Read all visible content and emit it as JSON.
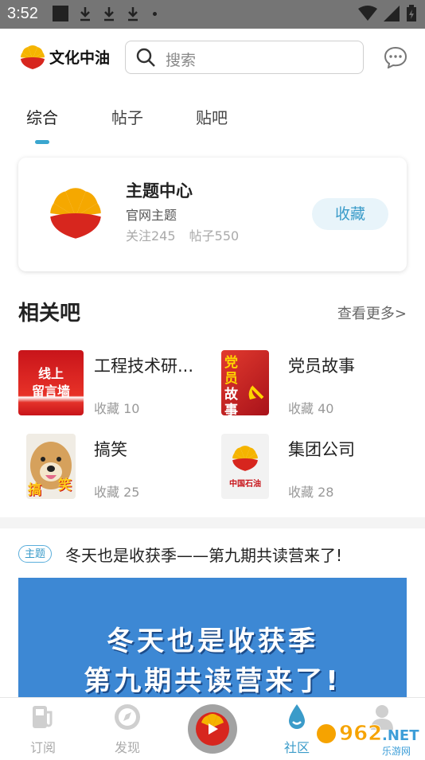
{
  "status_bar": {
    "time": "3:52"
  },
  "header": {
    "app_name": "文化中油",
    "search_placeholder": "搜索"
  },
  "tabs": [
    {
      "label": "综合",
      "active": true
    },
    {
      "label": "帖子",
      "active": false
    },
    {
      "label": "贴吧",
      "active": false
    }
  ],
  "topic_card": {
    "title": "主题中心",
    "subtitle": "官网主题",
    "followers": "关注245",
    "posts": "帖子550",
    "favorite_label": "收藏"
  },
  "related": {
    "title": "相关吧",
    "more_label": "查看更多>",
    "items": [
      {
        "name": "工程技术研...",
        "count": "收藏 10",
        "thumb_text": [
          "线上",
          "留言墙"
        ]
      },
      {
        "name": "党员故事",
        "count": "收藏 40",
        "thumb_text": [
          "党员",
          "故事"
        ]
      },
      {
        "name": "搞笑",
        "count": "收藏 25",
        "thumb_text": [
          "搞",
          "笑"
        ]
      },
      {
        "name": "集团公司",
        "count": "收藏 28",
        "thumb_text": [
          "中国石油"
        ]
      }
    ]
  },
  "post": {
    "badge": "主题",
    "title": "冬天也是收获季——第九期共读营来了!",
    "banner_lines": [
      "冬天也是收获季",
      "第九期共读营来了!"
    ]
  },
  "bottom_nav": [
    {
      "label": "订阅",
      "icon": "fuel-pump-icon",
      "active": false
    },
    {
      "label": "发现",
      "icon": "compass-icon",
      "active": false
    },
    {
      "label": "",
      "icon": "play-center-icon",
      "active": false
    },
    {
      "label": "社区",
      "icon": "drop-icon",
      "active": true
    },
    {
      "label": "",
      "icon": "user-icon",
      "active": false
    }
  ],
  "watermark": {
    "text": "962.NET",
    "sub": "乐游网"
  },
  "colors": {
    "accent": "#3a9bc9",
    "brand_red": "#d7261e",
    "brand_yellow": "#f5b400"
  }
}
